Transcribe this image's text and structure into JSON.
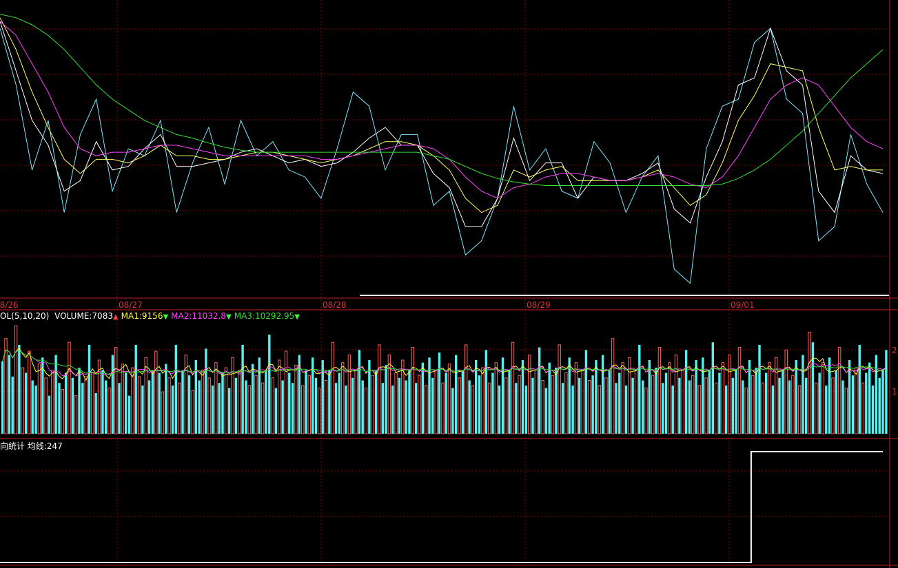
{
  "chart_data": {
    "type": "line",
    "x": [
      "08/26",
      "08/27",
      "08/28",
      "08/29",
      "09/01"
    ],
    "price_panel": {
      "series": [
        {
          "color": "#7fe6ff",
          "values": [
            380,
            300,
            180,
            250,
            120,
            230,
            280,
            150,
            210,
            200,
            250,
            120,
            190,
            240,
            160,
            250,
            200,
            220,
            180,
            170,
            140,
            210,
            290,
            270,
            180,
            230,
            230,
            130,
            150,
            60,
            80,
            140,
            270,
            180,
            210,
            150,
            140,
            220,
            190,
            120,
            170,
            200,
            40,
            20,
            210,
            270,
            280,
            360,
            380,
            280,
            260,
            80,
            100,
            230,
            160,
            120
          ]
        },
        {
          "color": "#ffffff",
          "values": [
            390,
            320,
            250,
            215,
            150,
            165,
            220,
            180,
            185,
            210,
            230,
            185,
            185,
            190,
            195,
            205,
            210,
            200,
            190,
            195,
            185,
            190,
            205,
            225,
            240,
            215,
            215,
            175,
            155,
            100,
            100,
            140,
            225,
            165,
            190,
            190,
            140,
            170,
            165,
            165,
            175,
            190,
            125,
            105,
            170,
            220,
            300,
            310,
            380,
            320,
            300,
            150,
            120,
            200,
            180,
            175
          ]
        },
        {
          "color": "#ffff66",
          "values": [
            395,
            350,
            290,
            240,
            195,
            175,
            195,
            195,
            190,
            200,
            215,
            200,
            200,
            195,
            195,
            200,
            205,
            205,
            200,
            195,
            190,
            195,
            200,
            210,
            220,
            220,
            215,
            200,
            180,
            140,
            120,
            130,
            180,
            170,
            180,
            185,
            165,
            165,
            165,
            165,
            170,
            180,
            155,
            130,
            145,
            190,
            250,
            285,
            330,
            325,
            320,
            240,
            180,
            185,
            180,
            180
          ]
        },
        {
          "color": "#ff44ff",
          "values": [
            390,
            370,
            330,
            290,
            240,
            210,
            200,
            205,
            205,
            210,
            215,
            215,
            210,
            205,
            200,
            200,
            200,
            200,
            200,
            200,
            195,
            195,
            200,
            205,
            210,
            215,
            215,
            210,
            195,
            170,
            150,
            140,
            155,
            160,
            170,
            175,
            175,
            170,
            165,
            165,
            170,
            175,
            170,
            160,
            155,
            170,
            200,
            240,
            280,
            300,
            310,
            300,
            270,
            240,
            220,
            210
          ]
        },
        {
          "color": "#33e033",
          "values": [
            400,
            395,
            385,
            370,
            350,
            325,
            300,
            280,
            265,
            250,
            240,
            230,
            225,
            218,
            212,
            208,
            205,
            205,
            205,
            205,
            205,
            205,
            205,
            205,
            205,
            205,
            205,
            200,
            195,
            185,
            175,
            168,
            163,
            160,
            158,
            158,
            158,
            158,
            158,
            158,
            158,
            158,
            158,
            158,
            158,
            160,
            168,
            180,
            195,
            215,
            235,
            260,
            285,
            310,
            330,
            350
          ]
        }
      ]
    },
    "volume_panel": {
      "label": "OL(5,10,20)",
      "indicators": [
        {
          "name": "VOLUME",
          "value": "7083",
          "dir": "up",
          "color": "#ffffff"
        },
        {
          "name": "MA1",
          "value": "9156",
          "dir": "down",
          "color": "#ffff33"
        },
        {
          "name": "MA2",
          "value": "11032.8",
          "dir": "down",
          "color": "#ff44ff"
        },
        {
          "name": "MA3",
          "value": "10292.95",
          "dir": "down",
          "color": "#33e033"
        }
      ],
      "axis_ticks": [
        "2",
        "1"
      ],
      "volume_values": [
        57,
        75,
        62,
        45,
        85,
        70,
        52,
        48,
        65,
        42,
        38,
        55,
        60,
        44,
        30,
        50,
        62,
        40,
        35,
        48,
        72,
        44,
        30,
        52,
        40,
        45,
        70,
        48,
        32,
        58,
        50,
        42,
        36,
        62,
        68,
        40,
        55,
        48,
        30,
        52,
        70,
        45,
        38,
        60,
        42,
        50,
        65,
        48,
        33,
        55,
        44,
        38,
        70,
        40,
        50,
        62,
        46,
        34,
        58,
        42,
        50,
        67,
        44,
        38,
        56,
        40,
        48,
        52,
        36,
        60,
        44,
        50,
        70,
        42,
        38,
        55,
        46,
        60,
        40,
        50,
        78,
        44,
        36,
        58,
        42,
        65,
        48,
        40,
        54,
        62,
        38,
        50,
        46,
        60,
        44,
        36,
        58,
        42,
        50,
        72,
        40,
        48,
        56,
        38,
        62,
        44,
        50,
        66,
        42,
        36,
        58,
        46,
        50,
        70,
        40,
        54,
        62,
        38,
        48,
        44,
        58,
        42,
        50,
        68,
        40,
        46,
        56,
        38,
        60,
        44,
        50,
        64,
        40,
        48,
        55,
        36,
        62,
        44,
        50,
        70,
        42,
        38,
        58,
        46,
        52,
        66,
        40,
        48,
        56,
        38,
        60,
        44,
        50,
        72,
        40,
        46,
        58,
        38,
        62,
        44,
        50,
        68,
        42,
        36,
        56,
        46,
        52,
        70,
        40,
        48,
        60,
        38,
        56,
        44,
        50,
        66,
        42,
        46,
        58,
        38,
        62,
        44,
        50,
        75,
        40,
        48,
        56,
        38,
        60,
        44,
        50,
        70,
        42,
        36,
        58,
        46,
        52,
        68,
        40,
        48,
        56,
        38,
        62,
        44,
        50,
        66,
        42,
        46,
        58,
        38,
        60,
        44,
        50,
        72,
        40,
        48,
        56,
        38,
        62,
        44,
        50,
        68,
        42,
        36,
        58,
        46,
        52,
        70,
        40,
        48,
        56,
        38,
        60,
        44,
        50,
        66,
        42,
        46,
        58,
        38,
        62,
        44,
        80,
        72,
        40,
        48,
        56,
        38,
        60,
        44,
        50,
        68,
        42,
        36,
        58,
        46,
        52,
        70,
        40,
        48,
        56,
        38,
        62,
        44,
        50,
        66
      ],
      "volume_up": [
        0,
        1,
        0,
        0,
        1,
        0,
        1,
        0,
        1,
        0,
        0,
        1,
        0,
        1,
        0,
        1,
        0,
        0,
        1,
        0,
        1,
        0,
        1,
        0,
        0,
        1,
        0,
        1,
        0,
        1,
        0,
        0,
        1,
        0,
        1,
        0,
        1,
        0,
        0,
        1,
        0,
        1,
        0,
        1,
        0,
        0,
        1,
        0,
        1,
        0,
        1,
        0,
        0,
        1,
        0,
        1,
        0,
        1,
        0,
        0,
        1,
        0,
        1,
        0,
        1,
        0,
        0,
        1,
        0,
        1,
        0,
        1,
        0,
        0,
        1,
        0,
        1,
        0,
        1,
        0,
        0,
        1,
        0,
        1,
        0,
        1,
        0,
        0,
        1,
        0,
        1,
        0,
        1,
        0,
        0,
        1,
        0,
        1,
        0,
        1,
        0,
        0,
        1,
        0,
        1,
        0,
        1,
        0,
        0,
        1,
        0,
        1,
        0,
        1,
        0,
        0,
        1,
        0,
        1,
        0,
        1,
        0,
        0,
        1,
        0,
        1,
        0,
        1,
        0,
        0,
        1,
        0,
        1,
        0,
        1,
        0,
        0,
        1,
        0,
        1,
        0,
        1,
        0,
        0,
        1,
        0,
        1,
        0,
        1,
        0,
        0,
        1,
        0,
        1,
        0,
        1,
        0,
        0,
        1,
        0,
        1,
        0,
        1,
        0,
        0,
        1,
        0,
        1,
        0,
        1,
        0,
        0,
        1,
        0,
        1,
        0,
        1,
        0,
        0,
        1,
        0,
        1,
        0,
        1,
        0,
        0,
        1,
        0,
        1,
        0,
        1,
        0,
        0,
        1,
        0,
        1,
        0,
        1,
        0,
        0,
        1,
        0,
        1,
        0,
        1,
        0,
        0,
        1,
        0,
        1,
        0,
        1,
        0,
        0,
        1,
        0,
        1,
        0,
        1,
        0,
        0,
        1,
        0,
        1,
        0,
        1,
        0,
        0,
        1,
        0,
        1,
        0,
        1,
        0,
        0,
        1,
        0,
        1,
        0,
        1,
        0,
        0,
        1,
        0,
        1,
        0,
        1,
        0,
        0,
        1,
        0,
        1,
        0,
        1,
        0,
        0,
        1,
        0,
        1,
        0
      ]
    },
    "stat_panel": {
      "label": "向统计 均线:247",
      "step_values": [
        0,
        0,
        0,
        0,
        0,
        0,
        0,
        0,
        0,
        0,
        0,
        0,
        0,
        0,
        0,
        0,
        0,
        0,
        0,
        0,
        0,
        0,
        0,
        0,
        0,
        0,
        0,
        0,
        0,
        0,
        0,
        0,
        0,
        0,
        0,
        0,
        0,
        0,
        0,
        0,
        0,
        0,
        0,
        0,
        0,
        0,
        0,
        0,
        0,
        0,
        0,
        0,
        0,
        0,
        0,
        0,
        0,
        0,
        0,
        0,
        0,
        0,
        0,
        0,
        0,
        0,
        0,
        0,
        0,
        0,
        0,
        0,
        0,
        0,
        0,
        0,
        0,
        0,
        0,
        0,
        0,
        0,
        0,
        0,
        0,
        0,
        0,
        0,
        0,
        0,
        0,
        0,
        0,
        0,
        0,
        0,
        0,
        0,
        0,
        0,
        0,
        0,
        0,
        0,
        0,
        0,
        0,
        0,
        0,
        0,
        0,
        0,
        0,
        0,
        0,
        0,
        0,
        0,
        0,
        0,
        0,
        0,
        0,
        0,
        0,
        0,
        0,
        0,
        0,
        0,
        0,
        0,
        0,
        0,
        0,
        0,
        0,
        0,
        0,
        0,
        0,
        0,
        0,
        0,
        0,
        0,
        0,
        0,
        0,
        0,
        0,
        0,
        0,
        0,
        0,
        0,
        0,
        0,
        0,
        0,
        0,
        0,
        0,
        0,
        0,
        0,
        0,
        0,
        0,
        0,
        0,
        0,
        0,
        0,
        0,
        0,
        0,
        0,
        0,
        0,
        0,
        0,
        0,
        0,
        0,
        0,
        0,
        0,
        0,
        0,
        0,
        0,
        0,
        0,
        0,
        0,
        0,
        0,
        0,
        0,
        0,
        0,
        0,
        0,
        0,
        0,
        0,
        0,
        0,
        0,
        0,
        0,
        0,
        0,
        0,
        0,
        0,
        0,
        0,
        0,
        0,
        0,
        0,
        0,
        0,
        0,
        0,
        0,
        0,
        0,
        0,
        0,
        0,
        0,
        0,
        0,
        0,
        0,
        0,
        0,
        0,
        0,
        0,
        0,
        0,
        0,
        0,
        0,
        0,
        0,
        0,
        1,
        1,
        1,
        1,
        1,
        1,
        1,
        1,
        1,
        1,
        1,
        1,
        1,
        1,
        1,
        1,
        1,
        1,
        1,
        1,
        1,
        1,
        1,
        1,
        1,
        1,
        1,
        1,
        1,
        1,
        1,
        1,
        1,
        1,
        1,
        1,
        1,
        1,
        1,
        1,
        1,
        1,
        1,
        1,
        1
      ]
    },
    "grid": true,
    "colors": {
      "background": "#000000",
      "grid": "#8b0000",
      "panel_border": "#c41e1e",
      "up_bar": "#ff6060",
      "down_bar": "#55f0f0"
    }
  }
}
